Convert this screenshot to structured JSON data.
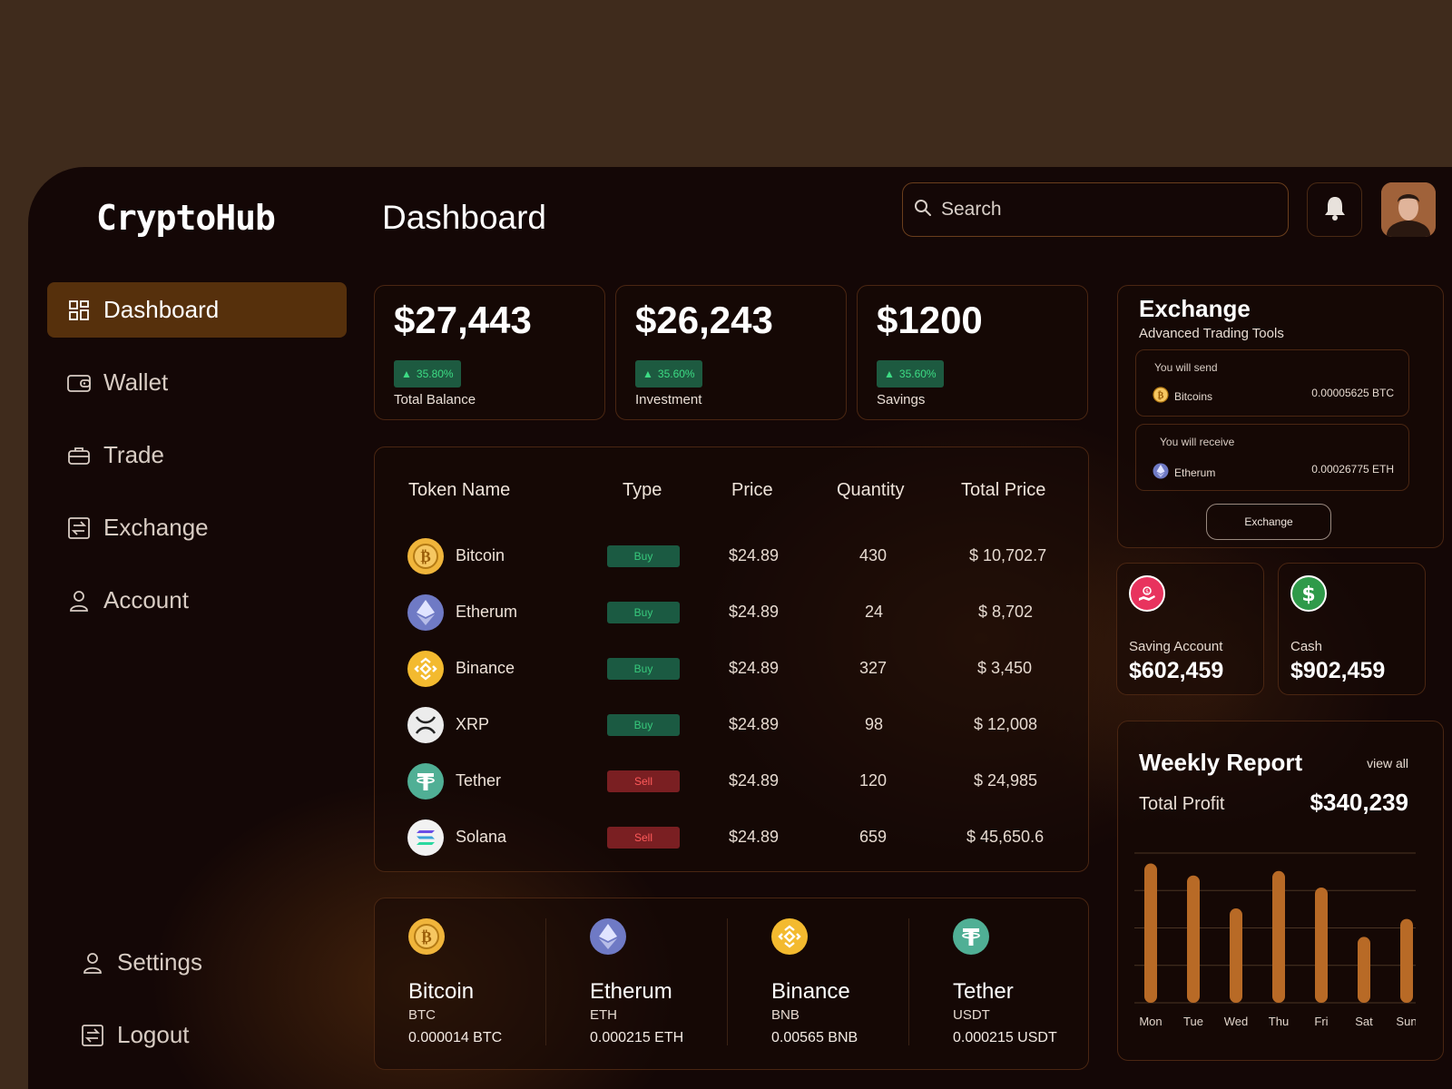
{
  "app": {
    "logo": "CryptoHub",
    "page_title": "Dashboard"
  },
  "search": {
    "placeholder": "Search"
  },
  "sidebar": {
    "items": [
      {
        "label": "Dashboard",
        "icon": "grid-icon",
        "active": true
      },
      {
        "label": "Wallet",
        "icon": "wallet-icon"
      },
      {
        "label": "Trade",
        "icon": "briefcase-icon"
      },
      {
        "label": "Exchange",
        "icon": "exchange-icon"
      },
      {
        "label": "Account",
        "icon": "user-icon"
      }
    ],
    "bottom": [
      {
        "label": "Settings",
        "icon": "user-icon"
      },
      {
        "label": "Logout",
        "icon": "exchange-icon"
      }
    ]
  },
  "stats": [
    {
      "amount": "$27,443",
      "change": "35.80%",
      "label": "Total Balance"
    },
    {
      "amount": "$26,243",
      "change": "35.60%",
      "label": "Investment"
    },
    {
      "amount": "$1200",
      "change": "35.60%",
      "label": "Savings"
    }
  ],
  "tokens": {
    "headers": {
      "name": "Token Name",
      "type": "Type",
      "price": "Price",
      "quantity": "Quantity",
      "total": "Total Price"
    },
    "rows": [
      {
        "name": "Bitcoin",
        "type": "Buy",
        "price": "$24.89",
        "quantity": "430",
        "total": "$ 10,702.7",
        "icon": "bitcoin-icon",
        "color": "#f0b53b"
      },
      {
        "name": "Etherum",
        "type": "Buy",
        "price": "$24.89",
        "quantity": "24",
        "total": "$ 8,702",
        "icon": "ethereum-icon",
        "color": "#6f7ac5"
      },
      {
        "name": "Binance",
        "type": "Buy",
        "price": "$24.89",
        "quantity": "327",
        "total": "$ 3,450",
        "icon": "binance-icon",
        "color": "#f3ba2f"
      },
      {
        "name": "XRP",
        "type": "Buy",
        "price": "$24.89",
        "quantity": "98",
        "total": "$ 12,008",
        "icon": "xrp-icon",
        "color": "#e8e8e8"
      },
      {
        "name": "Tether",
        "type": "Sell",
        "price": "$24.89",
        "quantity": "120",
        "total": "$ 24,985",
        "icon": "tether-icon",
        "color": "#50af95"
      },
      {
        "name": "Solana",
        "type": "Sell",
        "price": "$24.89",
        "quantity": "659",
        "total": "$ 45,650.6",
        "icon": "solana-icon",
        "color": "#f2f2f2"
      }
    ]
  },
  "coins": [
    {
      "name": "Bitcoin",
      "symbol": "BTC",
      "value": "0.000014 BTC",
      "icon": "bitcoin-icon"
    },
    {
      "name": "Etherum",
      "symbol": "ETH",
      "value": "0.000215 ETH",
      "icon": "ethereum-icon"
    },
    {
      "name": "Binance",
      "symbol": "BNB",
      "value": "0.00565 BNB",
      "icon": "binance-icon"
    },
    {
      "name": "Tether",
      "symbol": "USDT",
      "value": "0.000215 USDT",
      "icon": "tether-icon"
    }
  ],
  "exchange": {
    "title": "Exchange",
    "subtitle": "Advanced Trading Tools",
    "send": {
      "label": "You will send",
      "coin": "Bitcoins",
      "amount": "0.00005625 BTC"
    },
    "receive": {
      "label": "You will receive",
      "coin": "Etherum",
      "amount": "0.00026775 ETH"
    },
    "button": "Exchange"
  },
  "accounts": [
    {
      "label": "Saving Account",
      "value": "$602,459",
      "icon": "piggy-icon",
      "color": "#e8335e"
    },
    {
      "label": "Cash",
      "value": "$902,459",
      "icon": "dollar-icon",
      "color": "#2f9a4a"
    }
  ],
  "weekly": {
    "title": "Weekly Report",
    "view_all": "view all",
    "profit_label": "Total Profit",
    "profit_value": "$340,239"
  },
  "chart_data": {
    "type": "bar",
    "categories": [
      "Mon",
      "Tue",
      "Wed",
      "Thu",
      "Fri",
      "Sat",
      "Sun"
    ],
    "values": [
      93,
      85,
      63,
      88,
      77,
      44,
      56
    ],
    "ylim": [
      0,
      100
    ],
    "grid": true,
    "color": "#b86a26"
  }
}
